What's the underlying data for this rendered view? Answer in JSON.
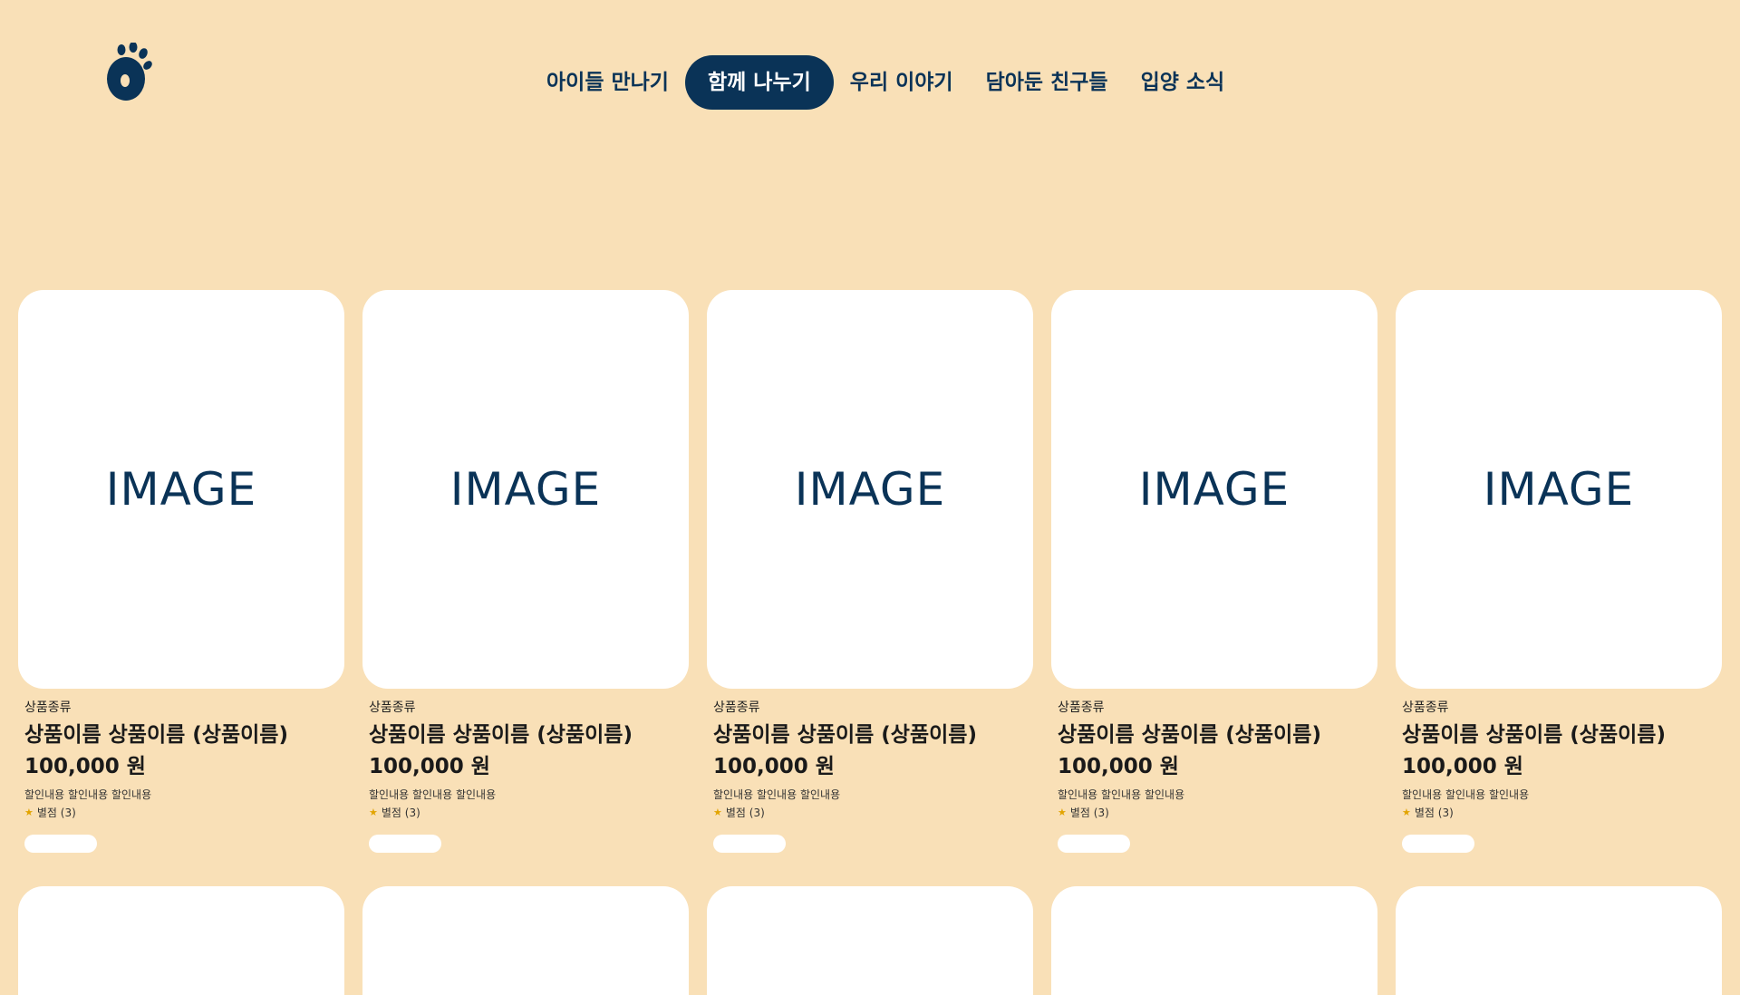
{
  "nav": {
    "items": [
      {
        "label": "아이들 만나기",
        "active": false
      },
      {
        "label": "함께 나누기",
        "active": true
      },
      {
        "label": "우리 이야기",
        "active": false
      },
      {
        "label": "담아둔 친구들",
        "active": false
      },
      {
        "label": "입양 소식",
        "active": false
      }
    ]
  },
  "logo": {
    "icon": "paw-logo-icon",
    "color": "#0a3357"
  },
  "colors": {
    "background": "#f9e0b7",
    "accent": "#0a3357",
    "card": "#ffffff",
    "star": "#e2a400"
  },
  "products": [
    {
      "image_label": "IMAGE",
      "category": "상품종류",
      "name": "상품이름 상품이름 (상품이름)",
      "price": "100,000 원",
      "discount": "할인내용 할인내용 할인내용",
      "rating": "별점 (3)"
    },
    {
      "image_label": "IMAGE",
      "category": "상품종류",
      "name": "상품이름 상품이름 (상품이름)",
      "price": "100,000 원",
      "discount": "할인내용 할인내용 할인내용",
      "rating": "별점 (3)"
    },
    {
      "image_label": "IMAGE",
      "category": "상품종류",
      "name": "상품이름 상품이름 (상품이름)",
      "price": "100,000 원",
      "discount": "할인내용 할인내용 할인내용",
      "rating": "별점 (3)"
    },
    {
      "image_label": "IMAGE",
      "category": "상품종류",
      "name": "상품이름 상품이름 (상품이름)",
      "price": "100,000 원",
      "discount": "할인내용 할인내용 할인내용",
      "rating": "별점 (3)"
    },
    {
      "image_label": "IMAGE",
      "category": "상품종류",
      "name": "상품이름 상품이름 (상품이름)",
      "price": "100,000 원",
      "discount": "할인내용 할인내용 할인내용",
      "rating": "별점 (3)"
    }
  ]
}
